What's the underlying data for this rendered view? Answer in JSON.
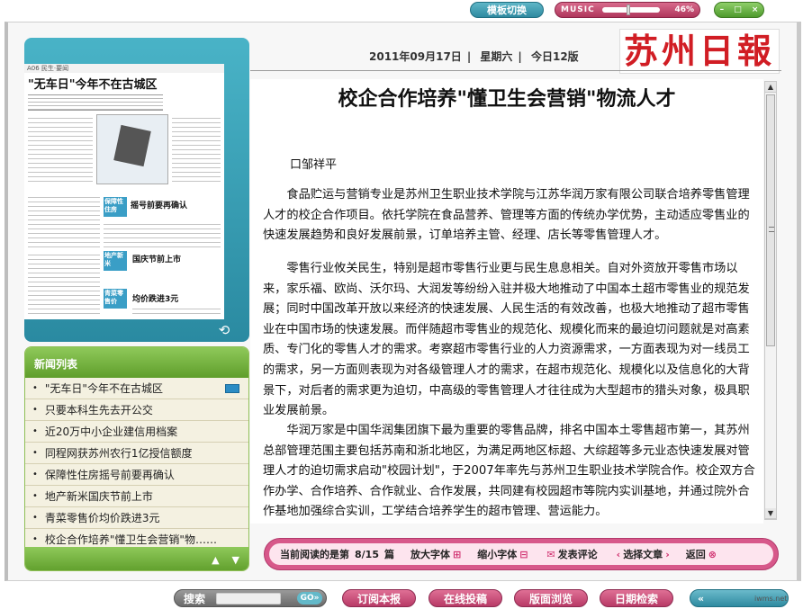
{
  "top": {
    "template_switch": "模板切换",
    "music_label": "MUSIC",
    "music_volume": "46%",
    "music_level": 0.46,
    "window_controls": [
      "–",
      "□",
      "×"
    ]
  },
  "thumbnail": {
    "page_label": "A06 民生·要闻",
    "headline": "\"无车日\"今年不在古城区",
    "blocks": [
      "保障性住房",
      "摇号前要再确认",
      "地产新米",
      "国庆节前上市",
      "青菜零售价",
      "均价跌进3元"
    ]
  },
  "news_list": {
    "header": "新闻列表",
    "items": [
      "\"无车日\"今年不在古城区",
      "只要本科生先去开公交",
      "近20万中小企业建信用档案",
      "同程网获苏州农行1亿授信额度",
      "保障性住房摇号前要再确认",
      "地产新米国庆节前上市",
      "青菜零售价均价跌进3元",
      "校企合作培养\"懂卫生会营销\"物……"
    ]
  },
  "header": {
    "date": "2011年09月17日",
    "weekday": "星期六",
    "today": "今日12版",
    "logo": "苏州日報"
  },
  "article": {
    "title": "校企合作培养\"懂卫生会营销\"物流人才",
    "byline": "口邹祥平",
    "paragraphs": [
      "食品贮运与营销专业是苏州卫生职业技术学院与江苏华润万家有限公司联合培养零售管理人才的校企合作项目。依托学院在食品营养、管理等方面的传统办学优势，主动适应零售业的快速发展趋势和良好发展前景，订单培养主管、经理、店长等零售管理人才。",
      "零售行业攸关民生，特别是超市零售行业更与民生息息相关。自对外资放开零售市场以来，家乐福、欧尚、沃尔玛、大润发等纷纷入驻并极大地推动了中国本土超市零售业的规范发展；同时中国改革开放以来经济的快速发展、人民生活的有效改善，也极大地推动了超市零售业在中国市场的快速发展。而伴随超市零售业的规范化、规模化而来的最迫切问题就是对高素质、专门化的零售人才的需求。考察超市零售行业的人力资源需求，一方面表现为对一线员工的需求，另一方面则表现为对各级管理人才的需求，在超市规范化、规模化以及信息化的大背景下，对后者的需求更为迫切，中高级的零售管理人才往往成为大型超市的猎头对象，极具职业发展前景。",
      "华润万家是中国华润集团旗下最为重要的零售品牌，排名中国本土零售超市第一，其苏州总部管理范围主要包括苏南和浙北地区，为满足两地区标超、大综超等多元业态快速发展对管理人才的迫切需求启动\"校园计划\"，于2007年率先与苏州卫生职业技术学院合作。校企双方合作办学、合作培养、合作就业、合作发展，共同建有校园超市等院内实训基地，并通过院外合作基地加强综合实训，工学结合培养学生的超市管理、营运能力。"
    ]
  },
  "reading_bar": {
    "current": "当前阅读的是第",
    "position": "8/15",
    "unit": "篇",
    "zoom_in": "放大字体",
    "zoom_out": "缩小字体",
    "comment": "发表评论",
    "select": "选择文章",
    "back": "返回"
  },
  "bottom": {
    "search_label": "搜索",
    "go": "GO",
    "subscribe": "订阅本报",
    "submit": "在线投稿",
    "browse": "版面浏览",
    "date_search": "日期检索",
    "prev": "«",
    "credit": "iwms.net"
  },
  "colors": {
    "accent_teal": "#2e8aa0",
    "accent_pink": "#d7588a",
    "accent_green": "#5f9e2b",
    "logo_red": "#d11d24"
  }
}
